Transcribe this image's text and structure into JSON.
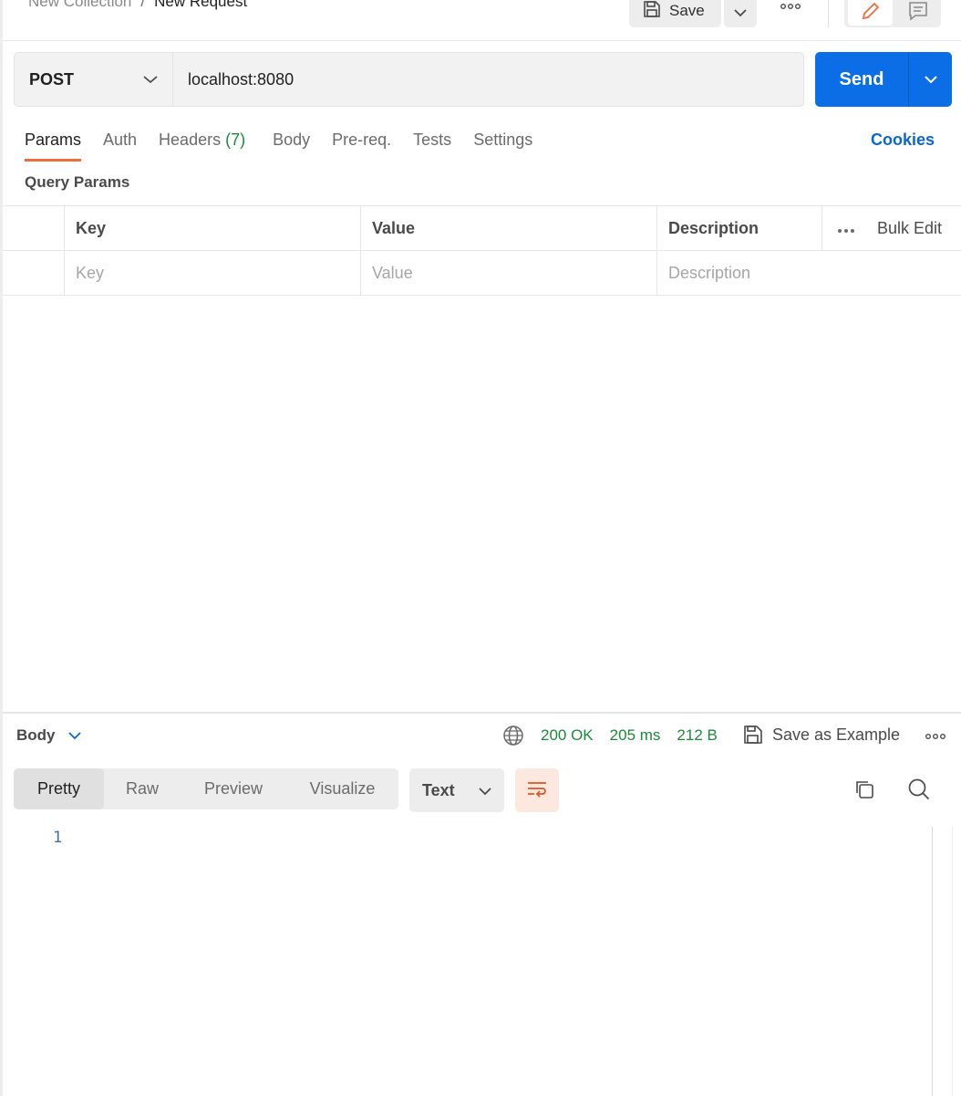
{
  "breadcrumb": {
    "collection": "New Collection",
    "separator": "/",
    "request": "New Request"
  },
  "toolbar": {
    "save_label": "Save"
  },
  "request": {
    "method": "POST",
    "url": "localhost:8080",
    "send_label": "Send"
  },
  "tabs": [
    {
      "label": "Params",
      "active": true
    },
    {
      "label": "Auth"
    },
    {
      "label": "Headers",
      "count": "(7)"
    },
    {
      "label": "Body"
    },
    {
      "label": "Pre-req."
    },
    {
      "label": "Tests"
    },
    {
      "label": "Settings"
    }
  ],
  "cookies_label": "Cookies",
  "query_params": {
    "title": "Query Params",
    "columns": [
      "Key",
      "Value",
      "Description"
    ],
    "bulk_edit": "Bulk Edit",
    "placeholders": {
      "key": "Key",
      "value": "Value",
      "description": "Description"
    }
  },
  "response": {
    "body_label": "Body",
    "status": "200 OK",
    "time": "205 ms",
    "size": "212 B",
    "save_example": "Save as Example",
    "view_tabs": [
      {
        "label": "Pretty",
        "active": true
      },
      {
        "label": "Raw"
      },
      {
        "label": "Preview"
      },
      {
        "label": "Visualize"
      }
    ],
    "format": "Text",
    "line_numbers": [
      "1"
    ]
  },
  "colors": {
    "accent_orange": "#f26b3a",
    "send_blue": "#0c6ee6",
    "link_blue": "#0b67d0",
    "success_green": "#1a8a3a"
  }
}
